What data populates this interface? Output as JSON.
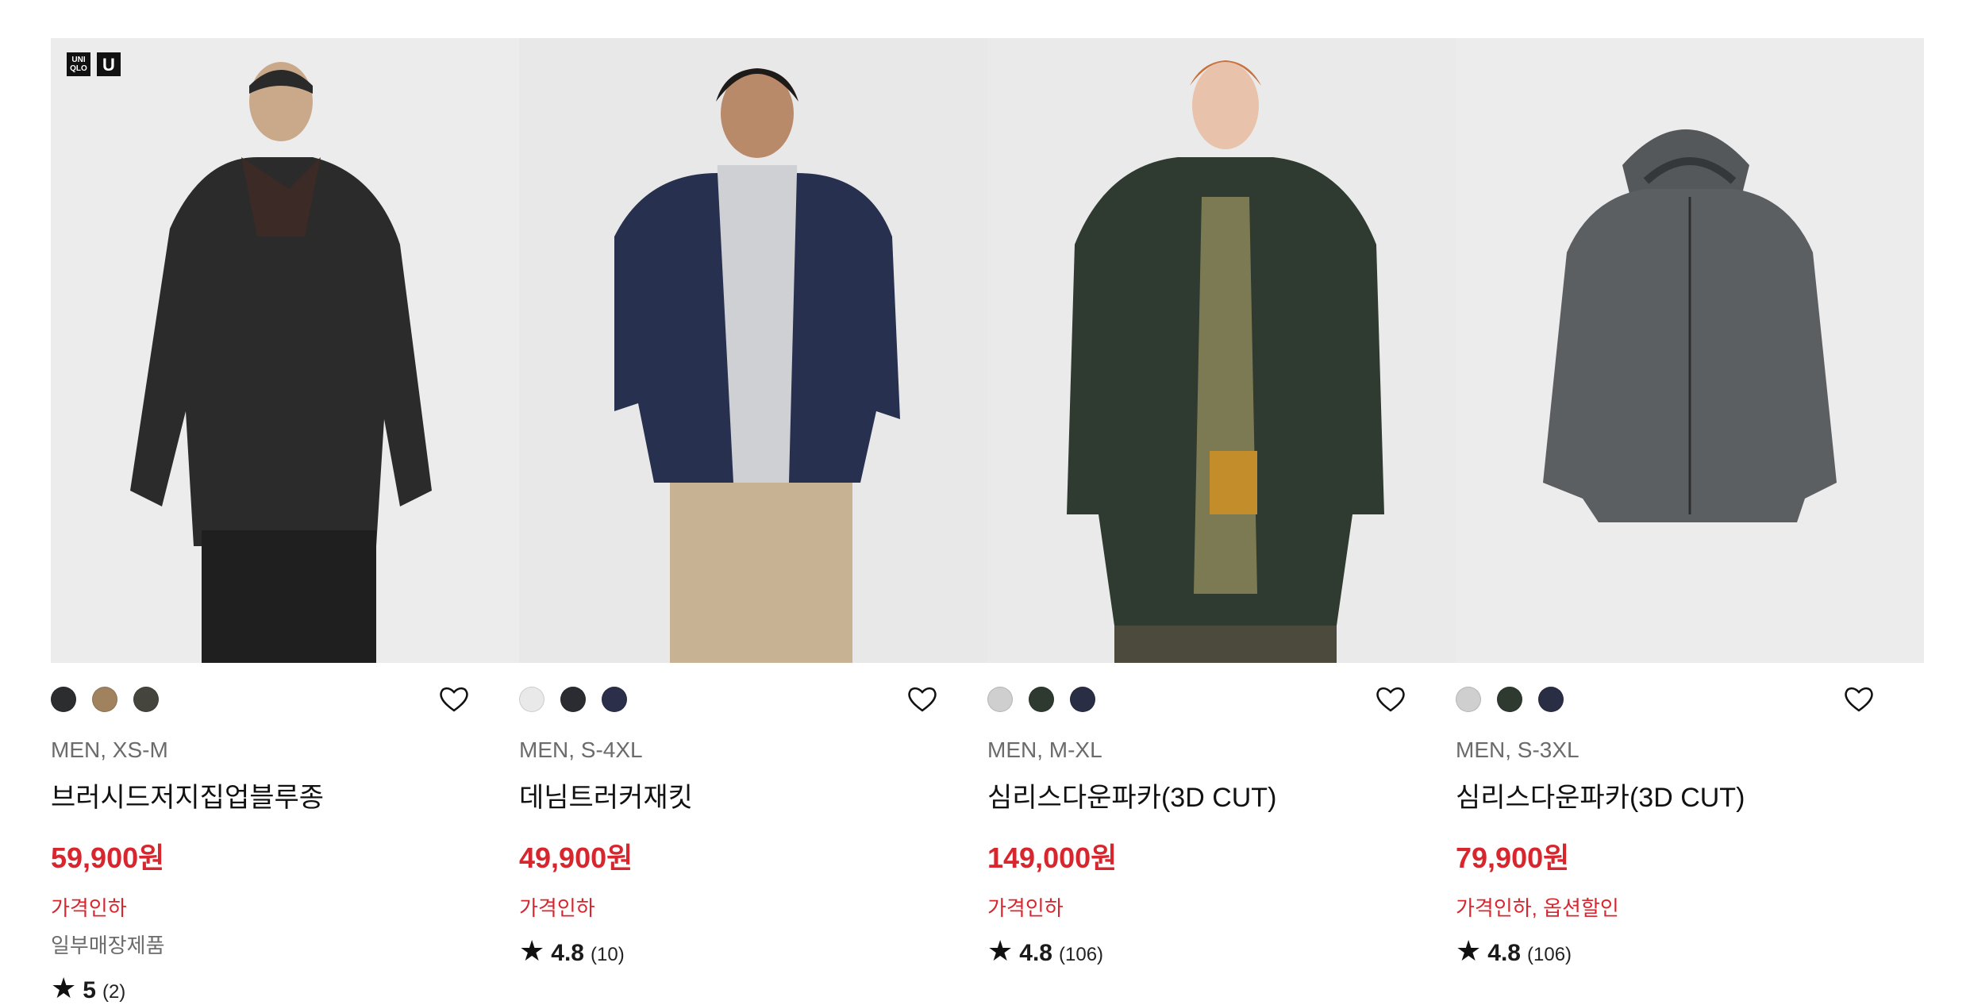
{
  "brand_badges": {
    "uniqlo": "UNI\nQLO",
    "u": "U"
  },
  "products": [
    {
      "meta": "MEN, XS-M",
      "name": "브러시드저지집업블루종",
      "price": "59,900원",
      "flag": "가격인하",
      "note": "일부매장제품",
      "rating": {
        "star": "★",
        "score": "5",
        "count": "(2)"
      },
      "swatches": [
        "#2b2d2f",
        "#a0825f",
        "#45453d"
      ]
    },
    {
      "meta": "MEN, S-4XL",
      "name": "데님트러커재킷",
      "price": "49,900원",
      "flag": "가격인하",
      "rating": {
        "star": "★",
        "score": "4.8",
        "count": "(10)"
      },
      "swatches": [
        "#e9e9e9",
        "#2a2c31",
        "#2b2f4a"
      ]
    },
    {
      "meta": "MEN, M-XL",
      "name": "심리스다운파카(3D CUT)",
      "price": "149,000원",
      "flag": "가격인하",
      "rating": {
        "star": "★",
        "score": "4.8",
        "count": "(106)"
      },
      "swatches": [
        "#cfcfcf",
        "#2e3a30",
        "#2a2e45"
      ]
    },
    {
      "meta": "MEN, S-3XL",
      "name": "심리스다운파카(3D CUT)",
      "price": "79,900원",
      "flag": "가격인하, 옵션할인",
      "rating": {
        "star": "★",
        "score": "4.8",
        "count": "(106)"
      },
      "swatches": [
        "#cfcfcf",
        "#2e3a30",
        "#2a2e45"
      ]
    }
  ],
  "colors": {
    "sale": "#d8262e",
    "muted": "#6b6b6b"
  }
}
